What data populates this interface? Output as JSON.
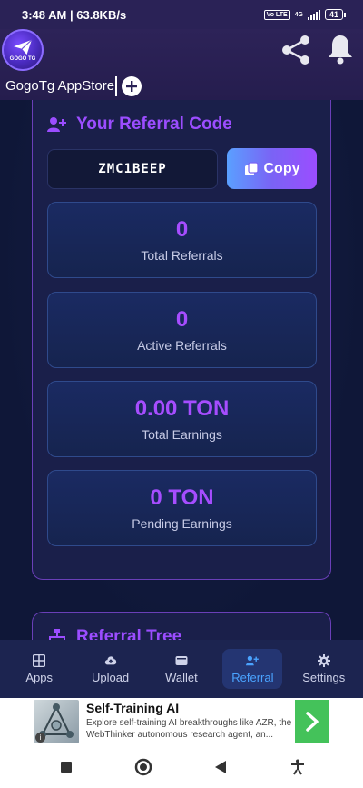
{
  "status_bar": {
    "time": "3:48 AM",
    "speed": "63.8KB/s",
    "volte": "Vo LTE",
    "network": "4G",
    "battery": "41"
  },
  "header": {
    "logo_text": "GOGO TG",
    "app_title": "GogoTg AppStore"
  },
  "referral": {
    "title": "Your Referral Code",
    "code": "ZMC1BEEP",
    "copy_label": "Copy",
    "stats": [
      {
        "value": "0",
        "label": "Total Referrals"
      },
      {
        "value": "0",
        "label": "Active Referrals"
      },
      {
        "value": "0.00 TON",
        "label": "Total Earnings"
      },
      {
        "value": "0 TON",
        "label": "Pending Earnings"
      }
    ],
    "tree_title": "Referral Tree"
  },
  "nav": {
    "items": [
      {
        "label": "Apps",
        "icon": "grid-icon"
      },
      {
        "label": "Upload",
        "icon": "cloud-upload-icon"
      },
      {
        "label": "Wallet",
        "icon": "wallet-icon"
      },
      {
        "label": "Referral",
        "icon": "user-plus-icon"
      },
      {
        "label": "Settings",
        "icon": "gear-icon"
      }
    ],
    "active": "Referral"
  },
  "ad": {
    "title": "Self-Training AI",
    "description": "Explore self-training AI breakthroughs like AZR, the WebThinker autonomous research agent, an...",
    "info": "i"
  },
  "colors": {
    "accent_purple": "#9b4dff",
    "active_blue": "#4aa3ff",
    "background": "#0f1738"
  }
}
